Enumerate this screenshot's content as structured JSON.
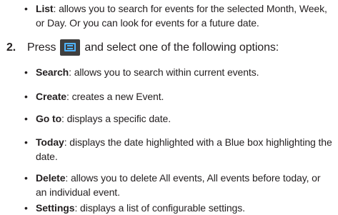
{
  "items_top": [
    {
      "term": "List",
      "text": ": allows you to search for events for the selected Month, Week, or Day. Or you can look for events for a future date."
    }
  ],
  "step": {
    "number": "2.",
    "before": "Press",
    "after": "and select one of the following options:",
    "icon": "menu-key-icon"
  },
  "options": [
    {
      "term": "Search",
      "text": ": allows you to search within current events."
    },
    {
      "term": "Create",
      "text": ": creates a new Event."
    },
    {
      "term": "Go to",
      "text": ": displays a specific date."
    },
    {
      "term": "Today",
      "text": ": displays the date highlighted with a Blue box highlighting the date."
    },
    {
      "term": "Delete",
      "text": ": allows you to delete All events, All events before today, or an individual event."
    },
    {
      "term": "Settings",
      "text": ": displays a list of configurable settings."
    }
  ],
  "bullet_glyph": "•"
}
